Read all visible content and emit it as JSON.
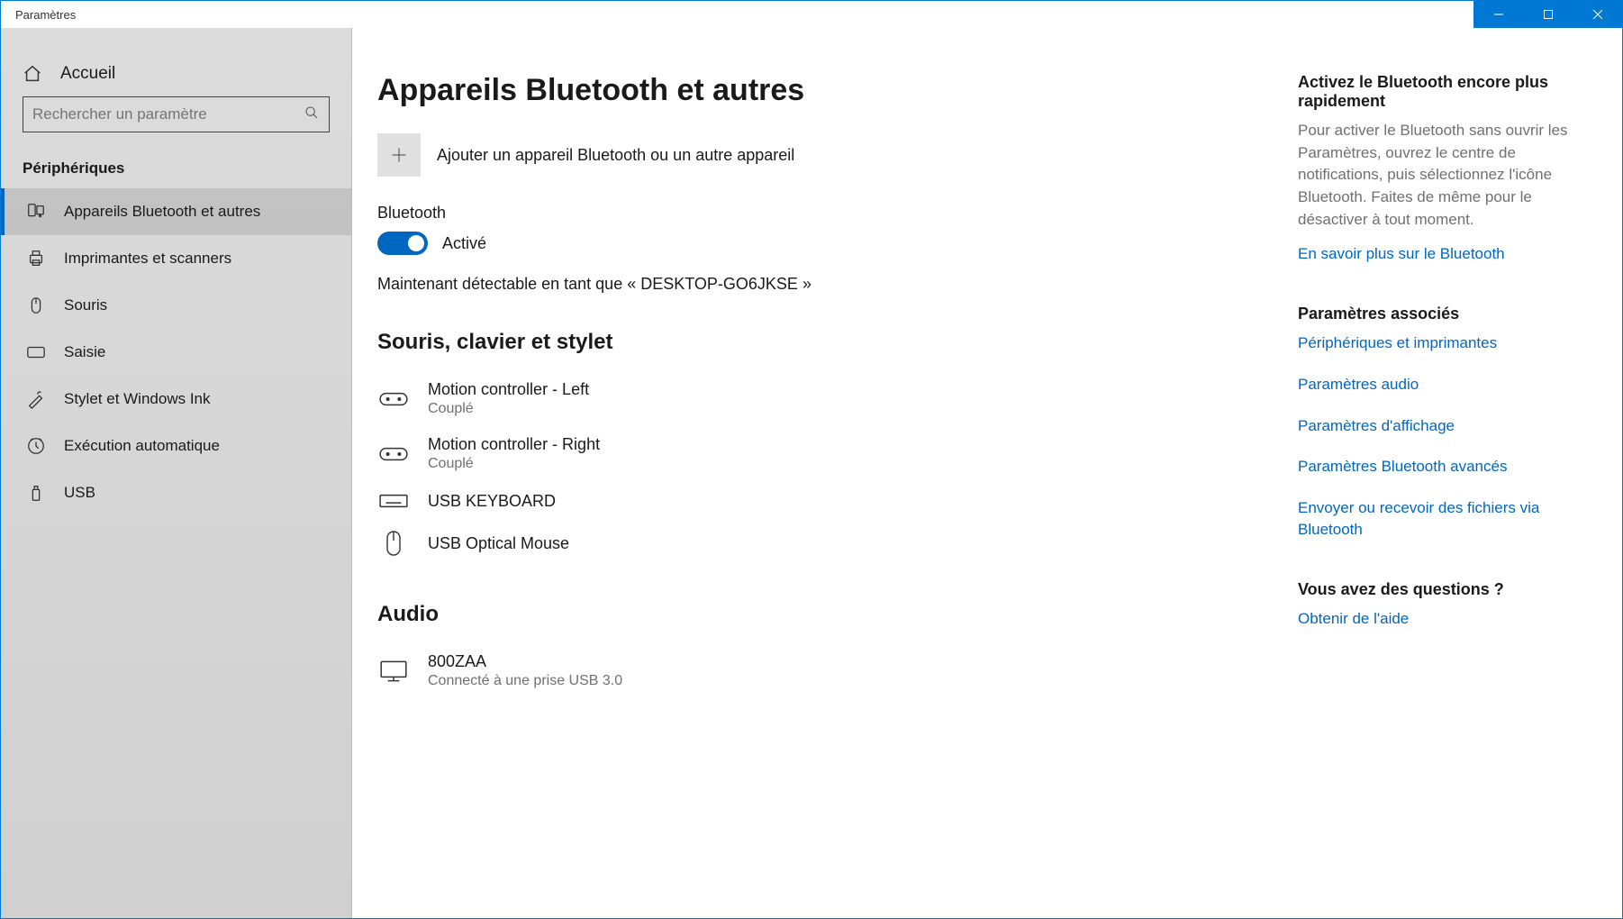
{
  "window_title": "Paramètres",
  "sidebar": {
    "home_label": "Accueil",
    "search_placeholder": "Rechercher un paramètre",
    "category_heading": "Périphériques",
    "items": [
      {
        "label": "Appareils Bluetooth et autres",
        "active": true
      },
      {
        "label": "Imprimantes et scanners",
        "active": false
      },
      {
        "label": "Souris",
        "active": false
      },
      {
        "label": "Saisie",
        "active": false
      },
      {
        "label": "Stylet et Windows Ink",
        "active": false
      },
      {
        "label": "Exécution automatique",
        "active": false
      },
      {
        "label": "USB",
        "active": false
      }
    ]
  },
  "page": {
    "title": "Appareils Bluetooth et autres",
    "add_label": "Ajouter un appareil Bluetooth ou un autre appareil",
    "bt_heading": "Bluetooth",
    "bt_status": "Activé",
    "discoverable_text": "Maintenant détectable en tant que « DESKTOP-GO6JKSE »",
    "section1_heading": "Souris, clavier et stylet",
    "devices1": [
      {
        "name": "Motion controller - Left",
        "status": "Couplé",
        "icon": "gamepad"
      },
      {
        "name": "Motion controller - Right",
        "status": "Couplé",
        "icon": "gamepad"
      },
      {
        "name": "USB KEYBOARD",
        "status": "",
        "icon": "keyboard"
      },
      {
        "name": "USB Optical Mouse",
        "status": "",
        "icon": "mouse"
      }
    ],
    "section2_heading": "Audio",
    "devices2": [
      {
        "name": "800ZAA",
        "status": "Connecté à une prise USB 3.0",
        "icon": "monitor"
      }
    ]
  },
  "aside": {
    "tip_heading": "Activez le Bluetooth encore plus rapidement",
    "tip_body": "Pour activer le Bluetooth sans ouvrir les Paramètres, ouvrez le centre de notifications, puis sélectionnez l'icône Bluetooth. Faites de même pour le désactiver à tout moment.",
    "tip_link": "En savoir plus sur le Bluetooth",
    "related_heading": "Paramètres associés",
    "related_links": [
      "Périphériques et imprimantes",
      "Paramètres audio",
      "Paramètres d'affichage",
      "Paramètres Bluetooth avancés",
      "Envoyer ou recevoir des fichiers via Bluetooth"
    ],
    "help_heading": "Vous avez des questions ?",
    "help_link": "Obtenir de l'aide"
  }
}
